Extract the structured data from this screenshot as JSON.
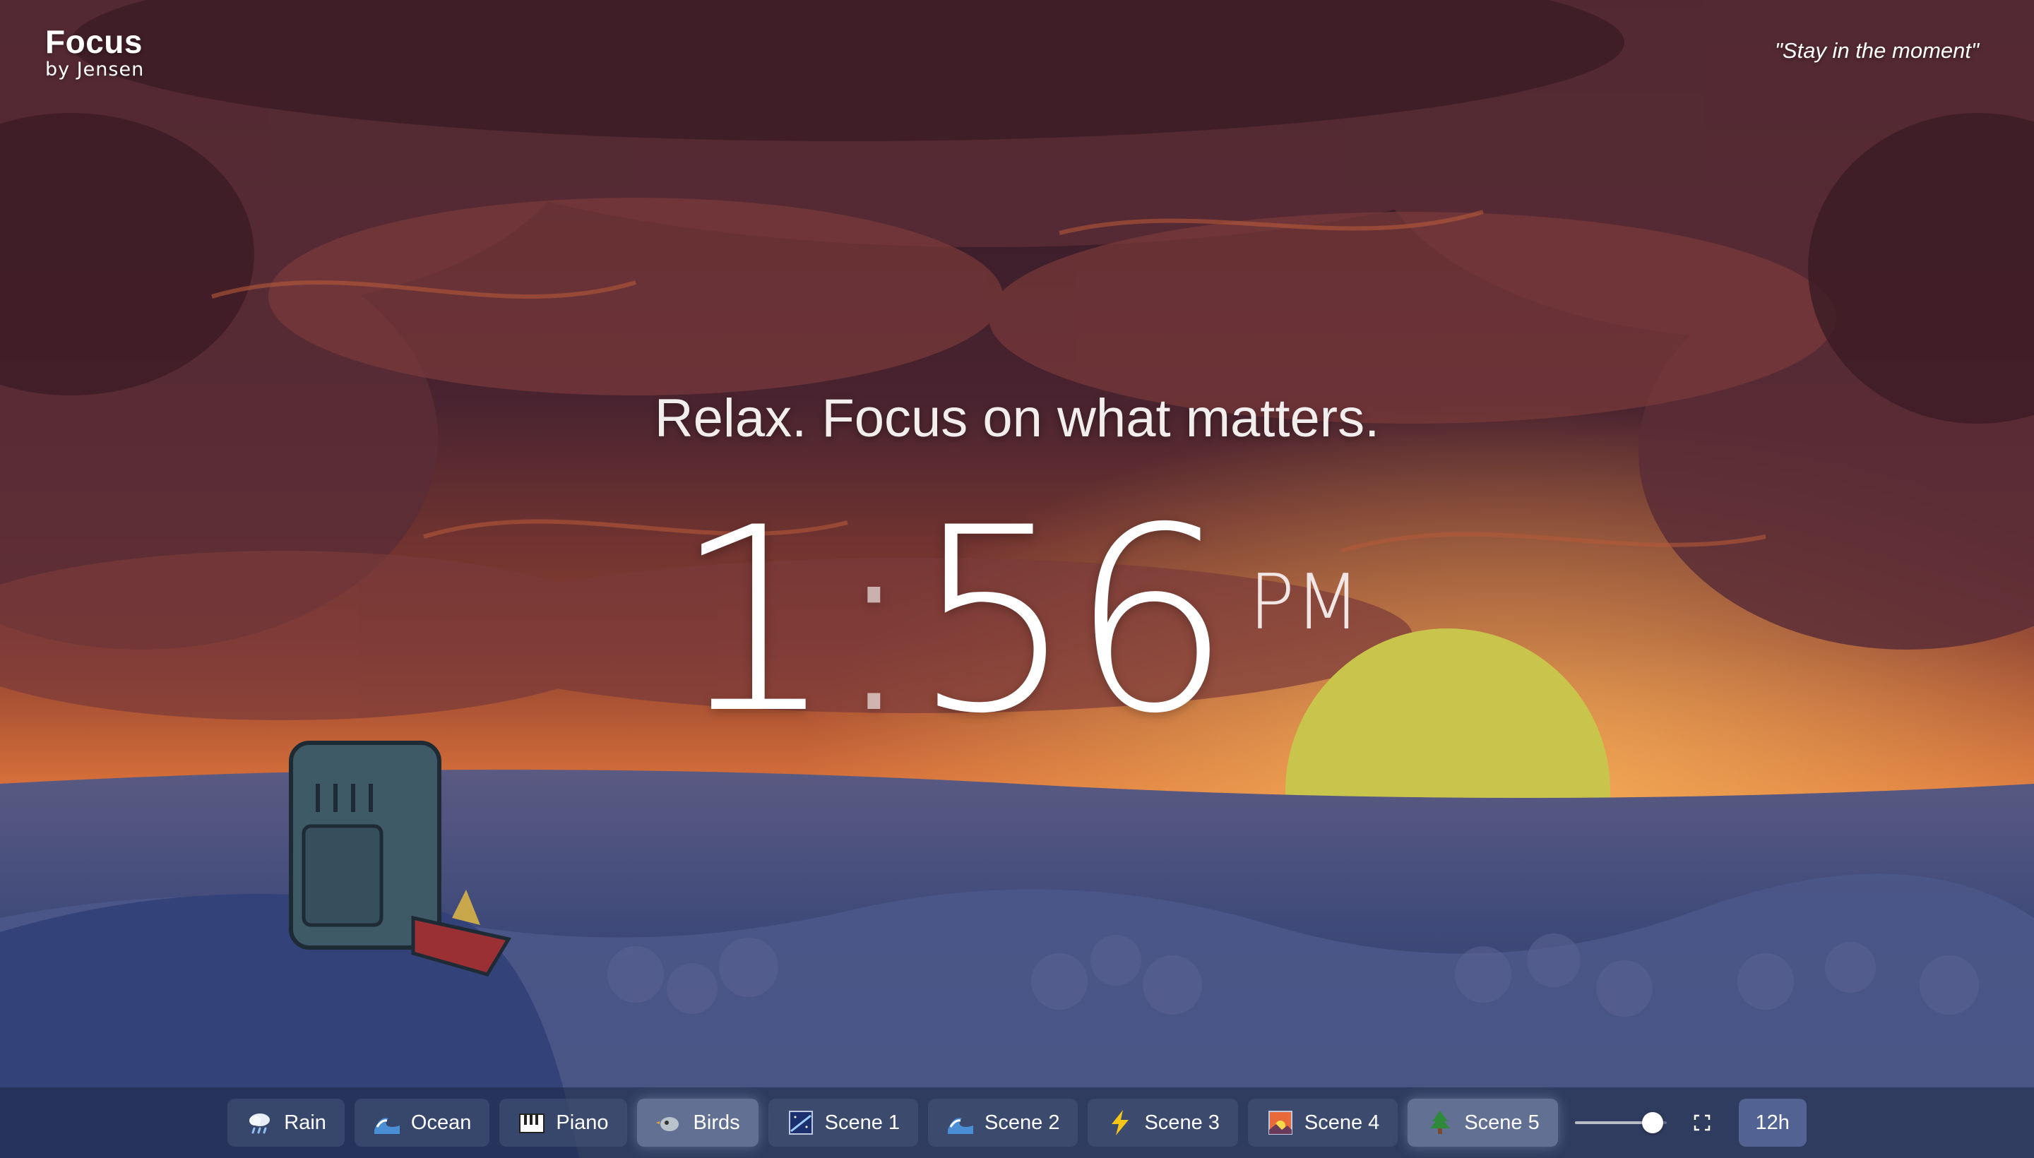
{
  "brand": {
    "title": "Focus",
    "subtitle": "by Jensen"
  },
  "quote": "\"Stay in the moment\"",
  "tagline": "Relax. Focus on what matters.",
  "clock": {
    "hours": "1",
    "colon": ":",
    "minutes": "56",
    "ampm": "PM"
  },
  "toolbar": {
    "buttons": [
      {
        "label": "Rain",
        "icon": "rain-cloud-icon",
        "active": false
      },
      {
        "label": "Ocean",
        "icon": "wave-icon",
        "active": false
      },
      {
        "label": "Piano",
        "icon": "piano-keys-icon",
        "active": false
      },
      {
        "label": "Birds",
        "icon": "bird-icon",
        "active": true
      },
      {
        "label": "Scene 1",
        "icon": "night-sky-icon",
        "active": false
      },
      {
        "label": "Scene 2",
        "icon": "wave-icon",
        "active": false
      },
      {
        "label": "Scene 3",
        "icon": "lightning-icon",
        "active": false
      },
      {
        "label": "Scene 4",
        "icon": "sunrise-icon",
        "active": false
      },
      {
        "label": "Scene 5",
        "icon": "tree-icon",
        "active": true
      }
    ],
    "volume": 0.85,
    "fullscreen_icon": "fullscreen-icon",
    "time_format": "12h"
  },
  "colors": {
    "sky_top": "#3a1f2c",
    "sunset": "#e07a3a",
    "sun": "#c9c34a",
    "forest": "#3a4a78",
    "toolbar_bg": "#1c2842"
  }
}
